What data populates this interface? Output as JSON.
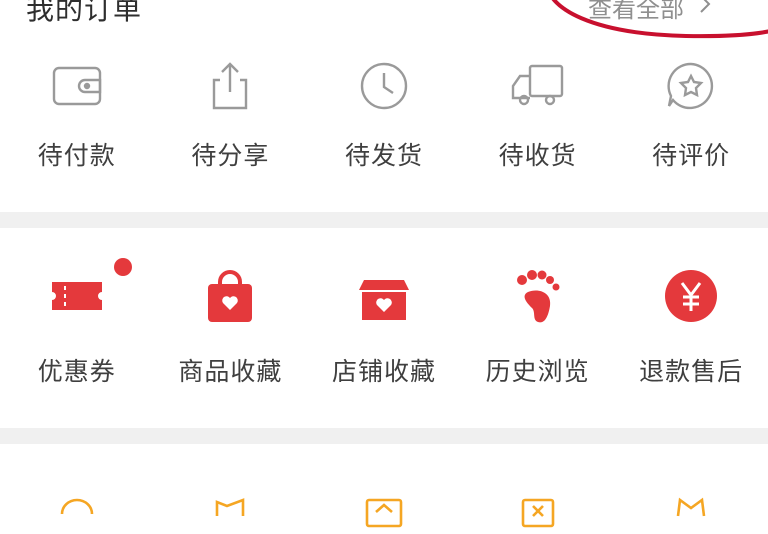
{
  "header": {
    "title": "我的订单",
    "view_all": "查看全部"
  },
  "orders": [
    {
      "label": "待付款",
      "icon": "wallet-icon"
    },
    {
      "label": "待分享",
      "icon": "share-icon"
    },
    {
      "label": "待发货",
      "icon": "clock-icon"
    },
    {
      "label": "待收货",
      "icon": "truck-icon"
    },
    {
      "label": "待评价",
      "icon": "star-bubble-icon"
    }
  ],
  "services": [
    {
      "label": "优惠券",
      "icon": "coupon-icon"
    },
    {
      "label": "商品收藏",
      "icon": "bag-heart-icon"
    },
    {
      "label": "店铺收藏",
      "icon": "shop-heart-icon"
    },
    {
      "label": "历史浏览",
      "icon": "footprint-icon"
    },
    {
      "label": "退款售后",
      "icon": "yuan-icon"
    }
  ],
  "colors": {
    "accent": "#e4393c",
    "outline_icon": "#9a9a9a",
    "orange_icon": "#f5a623",
    "annotation": "#c8102e"
  }
}
